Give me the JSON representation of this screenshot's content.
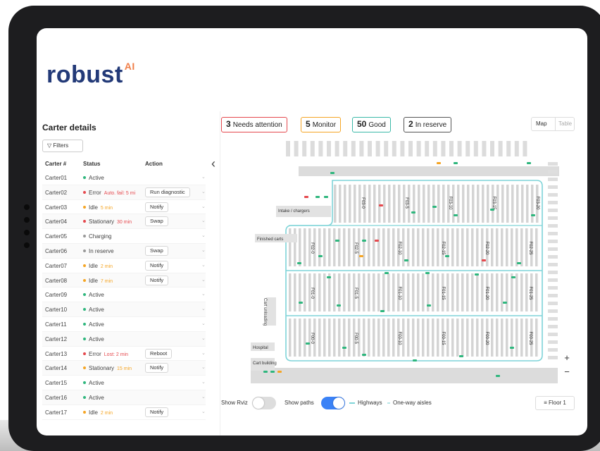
{
  "brand": {
    "name": "robust",
    "superscript": "AI",
    "color": "#233a78",
    "accent": "#f07f4a"
  },
  "left_panel": {
    "title": "Carter details",
    "filters_label": "Filters",
    "columns": {
      "id": "Carter #",
      "status": "Status",
      "action": "Action"
    },
    "rows": [
      {
        "id": "Carter01",
        "status": "Active",
        "color": "#2eb67d",
        "extra": "",
        "extra_color": "",
        "action": ""
      },
      {
        "id": "Carter02",
        "status": "Error",
        "color": "#e5484d",
        "extra": "Auto. fail: 5 mi",
        "extra_color": "#e5484d",
        "action": "Run diagnostic"
      },
      {
        "id": "Carter03",
        "status": "Idle",
        "color": "#f5a524",
        "extra": "5 min",
        "extra_color": "#f5a524",
        "action": "Notify"
      },
      {
        "id": "Carter04",
        "status": "Stationary",
        "color": "#e5484d",
        "extra": "30 min",
        "extra_color": "#e5484d",
        "action": "Swap"
      },
      {
        "id": "Carter05",
        "status": "Charging",
        "color": "#999999",
        "extra": "",
        "extra_color": "",
        "action": ""
      },
      {
        "id": "Carter06",
        "status": "In reserve",
        "color": "#999999",
        "extra": "",
        "extra_color": "",
        "action": "Swap"
      },
      {
        "id": "Carter07",
        "status": "Idle",
        "color": "#f5a524",
        "extra": "2 min",
        "extra_color": "#f5a524",
        "action": "Notify"
      },
      {
        "id": "Carter08",
        "status": "Idle",
        "color": "#f5a524",
        "extra": "7 min",
        "extra_color": "#f5a524",
        "action": "Notify"
      },
      {
        "id": "Carter09",
        "status": "Active",
        "color": "#2eb67d",
        "extra": "",
        "extra_color": "",
        "action": ""
      },
      {
        "id": "Carter10",
        "status": "Active",
        "color": "#2eb67d",
        "extra": "",
        "extra_color": "",
        "action": ""
      },
      {
        "id": "Carter11",
        "status": "Active",
        "color": "#2eb67d",
        "extra": "",
        "extra_color": "",
        "action": ""
      },
      {
        "id": "Carter12",
        "status": "Active",
        "color": "#2eb67d",
        "extra": "",
        "extra_color": "",
        "action": ""
      },
      {
        "id": "Carter13",
        "status": "Error",
        "color": "#e5484d",
        "extra": "Lost: 2 min",
        "extra_color": "#e5484d",
        "action": "Reboot"
      },
      {
        "id": "Carter14",
        "status": "Stationary",
        "color": "#f5a524",
        "extra": "15 min",
        "extra_color": "#f5a524",
        "action": "Notify"
      },
      {
        "id": "Carter15",
        "status": "Active",
        "color": "#2eb67d",
        "extra": "",
        "extra_color": "",
        "action": ""
      },
      {
        "id": "Carter16",
        "status": "Active",
        "color": "#2eb67d",
        "extra": "",
        "extra_color": "",
        "action": ""
      },
      {
        "id": "Carter17",
        "status": "Idle",
        "color": "#f5a524",
        "extra": "2 min",
        "extra_color": "#f5a524",
        "action": "Notify"
      }
    ]
  },
  "summary": [
    {
      "count": "3",
      "label": "Needs attention",
      "color": "#e5484d"
    },
    {
      "count": "5",
      "label": "Monitor",
      "color": "#f5a524"
    },
    {
      "count": "50",
      "label": "Good",
      "color": "#3bb8a8"
    },
    {
      "count": "2",
      "label": "In reserve",
      "color": "#555555"
    }
  ],
  "view_toggle": {
    "map": "Map",
    "table": "Table"
  },
  "map": {
    "zones": [
      "Intake / chargers",
      "Finished carts",
      "Cart unloading",
      "Hospital",
      "Cart building"
    ],
    "aisles": [
      "F03-0",
      "F03-5",
      "F03-10",
      "F03-15",
      "F03-20",
      "F02-0",
      "F02-5",
      "F02-10",
      "F02-15",
      "F02-20",
      "F02-25",
      "F01-0",
      "F01-5",
      "F01-10",
      "F01-15",
      "F01-20",
      "F01-25",
      "F00-0",
      "F00-5",
      "F00-10",
      "F00-15",
      "F00-20",
      "F00-25"
    ],
    "highway_color": "#7fd4d8",
    "rack_color": "#d4d4d4"
  },
  "zoom": {
    "in": "+",
    "out": "−"
  },
  "bottom": {
    "show_rviz": "Show Rviz",
    "show_paths": "Show paths",
    "highways": "Highways",
    "one_way": "One-way aisles",
    "floor": "Floor 1"
  }
}
